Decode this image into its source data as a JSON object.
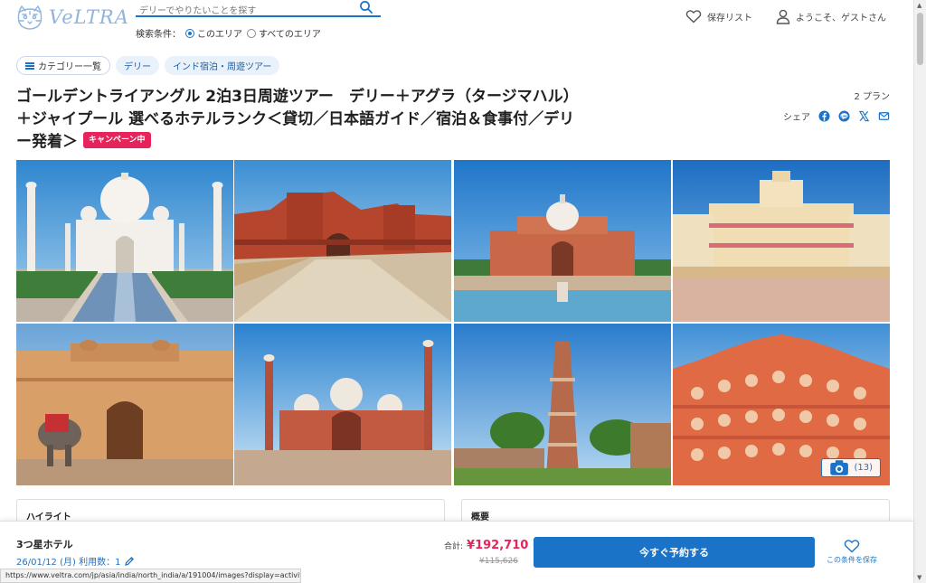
{
  "header": {
    "logo_text": "VeLTRA",
    "search_placeholder": "デリーでやりたいことを探す",
    "search_condition_label": "検索条件：",
    "search_options": [
      "このエリア",
      "すべてのエリア"
    ],
    "save_list_label": "保存リスト",
    "welcome_label": "ようこそ、ゲストさん"
  },
  "breadcrumbs": {
    "category_list": "カテゴリー一覧",
    "items": [
      "デリー",
      "インド宿泊・周遊ツアー"
    ]
  },
  "product": {
    "title": "ゴールデントライアングル 2泊3日周遊ツアー　デリー＋アグラ（タージマハル）＋ジャイプール 選べるホテルランク＜貸切／日本語ガイド／宿泊＆食事付／デリー発着＞",
    "campaign_badge": "キャンペーン中",
    "plan_count": "2 プラン",
    "share_label": "シェア",
    "share_icons": [
      "facebook-icon",
      "line-icon",
      "x-icon",
      "email-icon"
    ]
  },
  "gallery": {
    "photo_count": "(13)",
    "photos": [
      "taj-mahal-photo",
      "agra-fort-photo",
      "humayun-tomb-photo",
      "city-palace-photo",
      "amber-fort-photo",
      "jama-masjid-photo",
      "qutub-minar-photo",
      "hawa-mahal-photo"
    ]
  },
  "sections": {
    "highlight": "ハイライト",
    "overview": "概要"
  },
  "booking_bar": {
    "hotel": "3つ星ホテル",
    "date_people": "26/01/12 (月) 利用数：1",
    "total_label": "合計:",
    "price": "¥192,710",
    "original_price": "¥115,626",
    "book_button": "今すぐ予約する",
    "save_condition": "この条件を保存"
  },
  "status_url": "https://www.veltra.com/jp/asia/india/north_india/a/191004/images?display=activity&g...",
  "colors": {
    "primary": "#1a73c7",
    "accent_pink": "#e6235a",
    "logo": "#8fb4de"
  }
}
